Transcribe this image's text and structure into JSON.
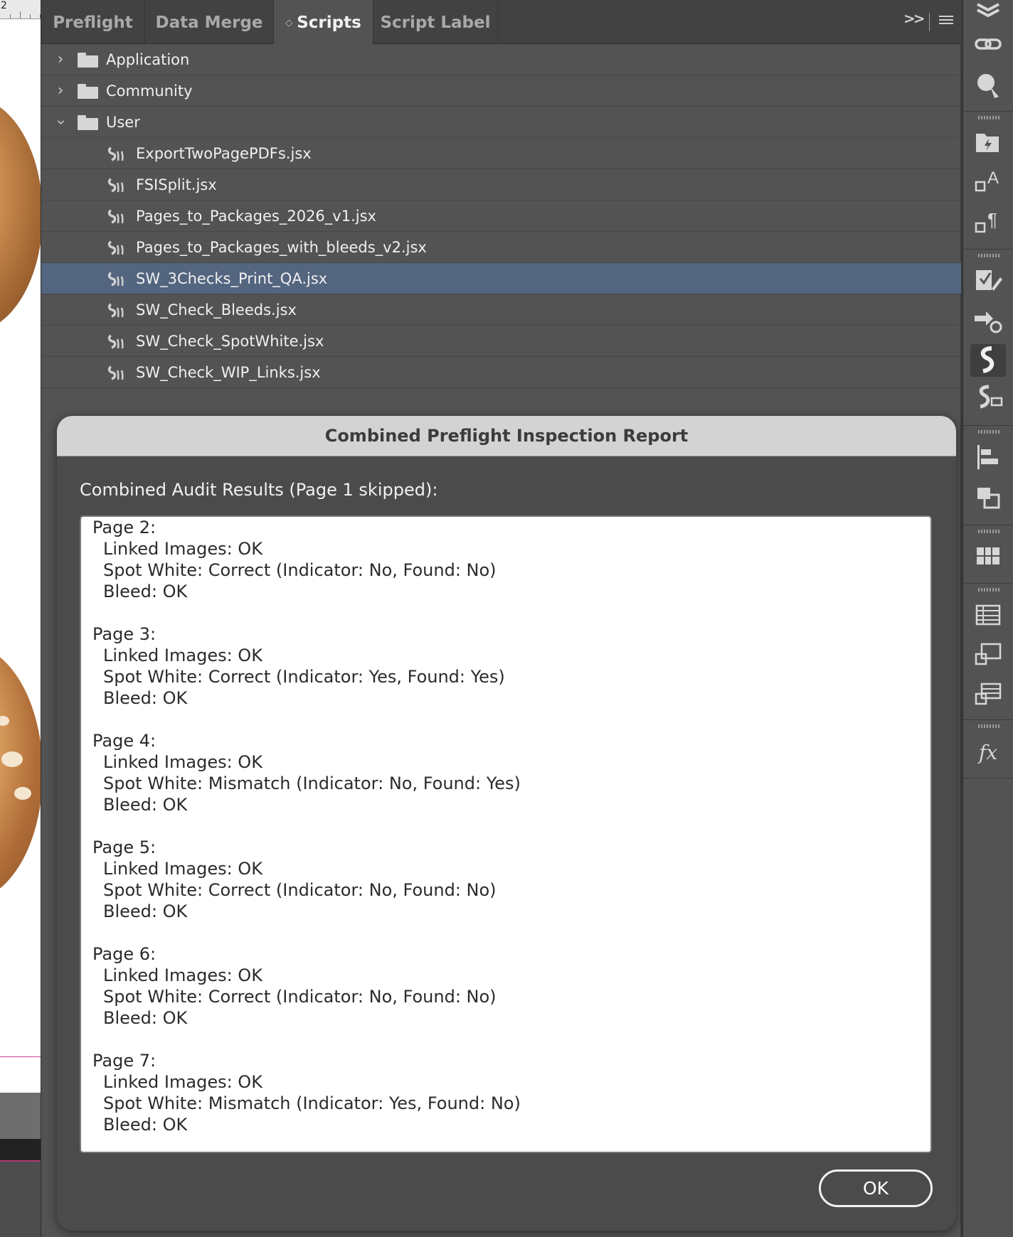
{
  "canvas": {
    "ruler_number": "2"
  },
  "panel": {
    "tabs": [
      {
        "label": "Preflight",
        "active": false
      },
      {
        "label": "Data Merge",
        "active": false
      },
      {
        "label": "Scripts",
        "active": true
      },
      {
        "label": "Script Label",
        "active": false
      }
    ],
    "collapse_glyph": ">>",
    "tree": {
      "folders": [
        {
          "label": "Application",
          "expanded": false
        },
        {
          "label": "Community",
          "expanded": false
        },
        {
          "label": "User",
          "expanded": true
        }
      ],
      "scripts": [
        {
          "label": "ExportTwoPagePDFs.jsx",
          "selected": false
        },
        {
          "label": "FSISplit.jsx",
          "selected": false
        },
        {
          "label": "Pages_to_Packages_2026_v1.jsx",
          "selected": false
        },
        {
          "label": "Pages_to_Packages_with_bleeds_v2.jsx",
          "selected": false
        },
        {
          "label": "SW_3Checks_Print_QA.jsx",
          "selected": true
        },
        {
          "label": "SW_Check_Bleeds.jsx",
          "selected": false
        },
        {
          "label": "SW_Check_SpotWhite.jsx",
          "selected": false
        },
        {
          "label": "SW_Check_WIP_Links.jsx",
          "selected": false
        }
      ]
    }
  },
  "dialog": {
    "title": "Combined Preflight Inspection Report",
    "heading": "Combined Audit Results (Page 1 skipped):",
    "ok_label": "OK",
    "pages": [
      {
        "page": "Page 2:",
        "linked": "Linked Images: OK",
        "spot": "Spot White: Correct (Indicator: No, Found: No)",
        "bleed": "Bleed: OK"
      },
      {
        "page": "Page 3:",
        "linked": "Linked Images: OK",
        "spot": "Spot White: Correct (Indicator: Yes, Found: Yes)",
        "bleed": "Bleed: OK"
      },
      {
        "page": "Page 4:",
        "linked": "Linked Images: OK",
        "spot": "Spot White: Mismatch (Indicator: No, Found: Yes)",
        "bleed": "Bleed: OK"
      },
      {
        "page": "Page 5:",
        "linked": "Linked Images: OK",
        "spot": "Spot White: Correct (Indicator: No, Found: No)",
        "bleed": "Bleed: OK"
      },
      {
        "page": "Page 6:",
        "linked": "Linked Images: OK",
        "spot": "Spot White: Correct (Indicator: No, Found: No)",
        "bleed": "Bleed: OK"
      },
      {
        "page": "Page 7:",
        "linked": "Linked Images: OK",
        "spot": "Spot White: Mismatch (Indicator: Yes, Found: No)",
        "bleed": "Bleed: OK"
      }
    ]
  },
  "rail": {
    "icons": [
      "layers-icon",
      "links-icon",
      "color-theme-icon",
      "cc-libraries-icon",
      "character-styles-icon",
      "paragraph-styles-icon",
      "edit-icon",
      "object-styles-icon",
      "scripts-icon",
      "script-label-icon",
      "align-icon",
      "pathfinder-icon",
      "swatches-grid-icon",
      "table-icon",
      "table-styles-icon",
      "cell-styles-icon",
      "effects-fx-icon"
    ],
    "active_icon": "scripts-icon"
  },
  "colors": {
    "panel_bg": "#535353",
    "tab_bar_bg": "#424242",
    "selection": "#53657f",
    "dialog_bg": "#4b4b4b",
    "dialog_titlebar": "#d3d3d3"
  }
}
